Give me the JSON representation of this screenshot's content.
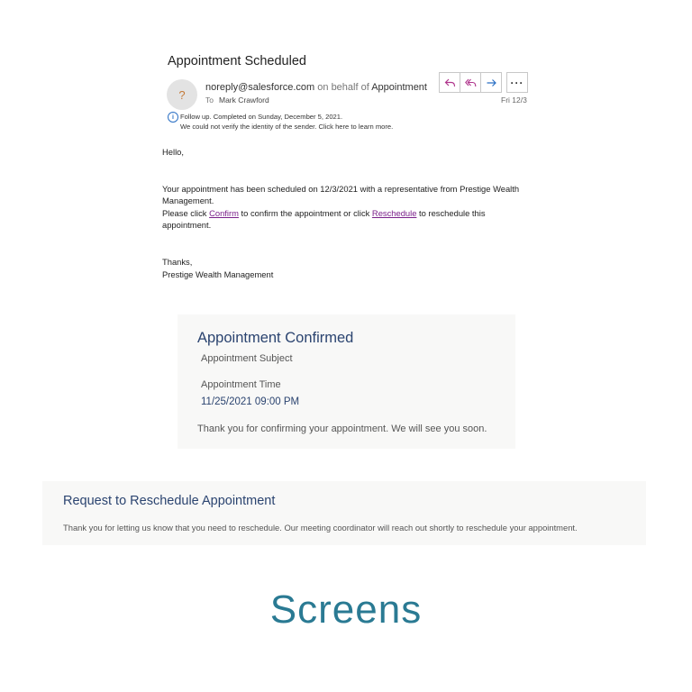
{
  "email": {
    "subject": "Appointment Scheduled",
    "avatar_glyph": "?",
    "sender_address": "noreply@salesforce.com",
    "sender_mid": " on behalf of ",
    "sender_name": "Appointments",
    "to_label": "To",
    "to_name": "Mark Crawford",
    "date": "Fri 12/3",
    "actions": {
      "reply_icon": "reply-icon",
      "reply_all_icon": "reply-all-icon",
      "forward_icon": "forward-icon",
      "more_icon": "more-icon"
    },
    "info_line1": "Follow up.  Completed on Sunday, December 5, 2021.",
    "info_line2": "We could not verify the identity of the sender. Click here to learn more.",
    "greeting": "Hello,",
    "body_line1": "Your appointment has been scheduled on 12/3/2021 with a representative from Prestige Wealth Management.",
    "body_pre": "Please click ",
    "confirm_link": "Confirm",
    "body_mid": " to confirm the appointment or click ",
    "reschedule_link": "Reschedule",
    "body_post": " to reschedule this appointment.",
    "signoff": "Thanks,",
    "signature": "Prestige Wealth Management"
  },
  "confirmed": {
    "title": "Appointment Confirmed",
    "subject": "Appointment Subject",
    "time_label": "Appointment Time",
    "time_value": "11/25/2021 09:00 PM",
    "message": "Thank you for confirming your appointment. We will see you soon."
  },
  "reschedule": {
    "title": "Request to Reschedule Appointment",
    "message": "Thank you for letting us know that you need to reschedule. Our meeting coordinator will reach out shortly to reschedule your appointment."
  },
  "caption": "Screens",
  "colors": {
    "heading_blue": "#2b4470",
    "caption_teal": "#2a7a93",
    "link_purple": "#7a1f8a",
    "panel_bg": "#f8f8f7"
  }
}
